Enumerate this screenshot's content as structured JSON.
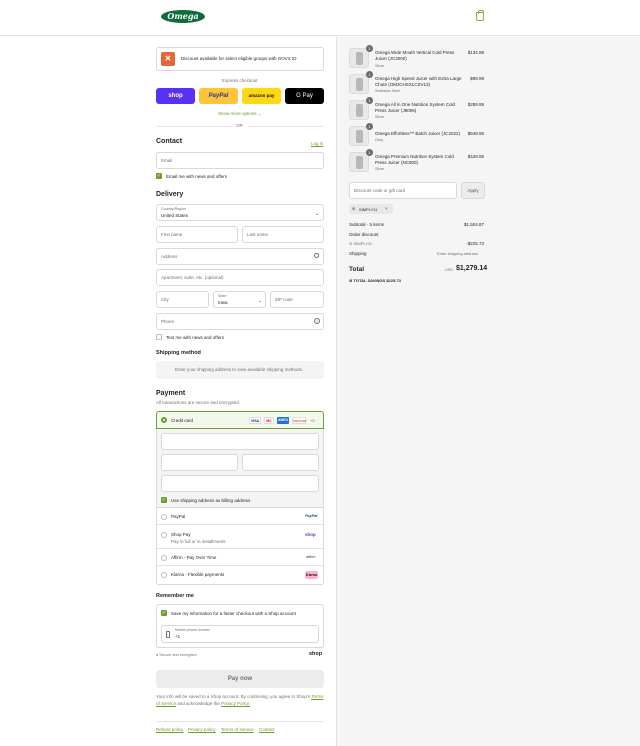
{
  "header": {
    "logo": "Omega",
    "cart_icon": "shopping-bag-icon"
  },
  "govx": {
    "text": "Discount available for select eligible groups with GOVX ID",
    "icon": "govx-icon"
  },
  "express": {
    "label": "Express checkout",
    "buttons": [
      "shop",
      "PayPal",
      "amazon pay",
      "G Pay"
    ],
    "more_options": "Show more options ⌄",
    "or": "OR"
  },
  "contact": {
    "title": "Contact",
    "login": "Log in",
    "email_placeholder": "Email",
    "news_label": "Email me with news and offers"
  },
  "delivery": {
    "title": "Delivery",
    "country_label": "Country/Region",
    "country_value": "United States",
    "first_name": "First name",
    "last_name": "Last name",
    "address": "Address",
    "apartment": "Apartment, suite, etc. (optional)",
    "city": "City",
    "state_label": "State",
    "state_value": "Iowa",
    "zip": "ZIP code",
    "phone": "Phone",
    "text_label": "Text me with news and offers"
  },
  "shipping_method": {
    "title": "Shipping method",
    "info": "Enter your shipping address to view available shipping methods."
  },
  "payment": {
    "title": "Payment",
    "subtitle": "All transactions are secure and encrypted.",
    "credit_card": "Credit card",
    "cards": [
      "VISA",
      "MC",
      "AMEX",
      "DISCOVER"
    ],
    "more_cards": "+5",
    "billing_label": "Use shipping address as billing address",
    "options": [
      {
        "label": "PayPal",
        "sub": "",
        "logo": "PayPal"
      },
      {
        "label": "Shop Pay",
        "sub": "Pay in full or in installments",
        "logo": "shop"
      },
      {
        "label": "Affirm - Pay Over Time",
        "sub": "",
        "logo": "affirm"
      },
      {
        "label": "Klarna - Flexible payments",
        "sub": "",
        "logo": "Klarna"
      }
    ]
  },
  "remember": {
    "title": "Remember me",
    "save_label": "Save my information for a faster checkout with a Shop account",
    "mobile_label": "Mobile phone number",
    "mobile_value": "+1",
    "secure": "Secure and encrypted",
    "shop": "shop"
  },
  "pay_now": "Pay now",
  "legal": {
    "text": "Your info will be saved to a Shop account. By continuing, you agree to Shop's",
    "terms": "Terms of Service",
    "and": "and acknowledge the",
    "privacy": "Privacy Policy."
  },
  "footer": [
    "Refund policy",
    "Privacy policy",
    "Terms of service",
    "Contact"
  ],
  "cart": {
    "items": [
      {
        "qty": "1",
        "name": "Omega Wide Mouth Vertical Cold Press Juicer (JC4000)",
        "variant": "Silver",
        "price": "$134.99"
      },
      {
        "qty": "1",
        "name": "Omega High Speed Juicer with Extra Large Chute (OMJCHSXLCSV13)",
        "variant": "Stainless Steel",
        "price": "$99.99"
      },
      {
        "qty": "1",
        "name": "Omega All in One Nutrition System Cold Press Juicer (J8006)",
        "variant": "Silver",
        "price": "$289.99"
      },
      {
        "qty": "1",
        "name": "Omega Effortless™ Batch Juicer (JC2022)",
        "variant": "Grey",
        "price": "$549.95"
      },
      {
        "qty": "1",
        "name": "Omega Premium Nutrition System Cold Press Juicer (NC900)",
        "variant": "Silver",
        "price": "$429.95"
      }
    ],
    "discount_placeholder": "Discount code or gift card",
    "apply": "Apply",
    "code_tag": "SIMPLY11",
    "subtotal_label": "Subtotal · 5 items",
    "subtotal": "$1,504.87",
    "order_discount_label": "Order discount",
    "discount_code": "SIMPLY11",
    "discount_value": "-$225.73",
    "shipping_label": "Shipping",
    "shipping_value": "Enter shipping address",
    "total_label": "Total",
    "currency": "USD",
    "total": "$1,279.14",
    "savings_label": "TOTAL SAVINGS",
    "savings": "$225.73"
  },
  "colors": {
    "accent": "#6d9d2e",
    "shop": "#5a31f4",
    "paypal": "#ffc439",
    "amazon": "#ffd814",
    "gpay": "#000000",
    "brand": "#0f6b3a"
  }
}
